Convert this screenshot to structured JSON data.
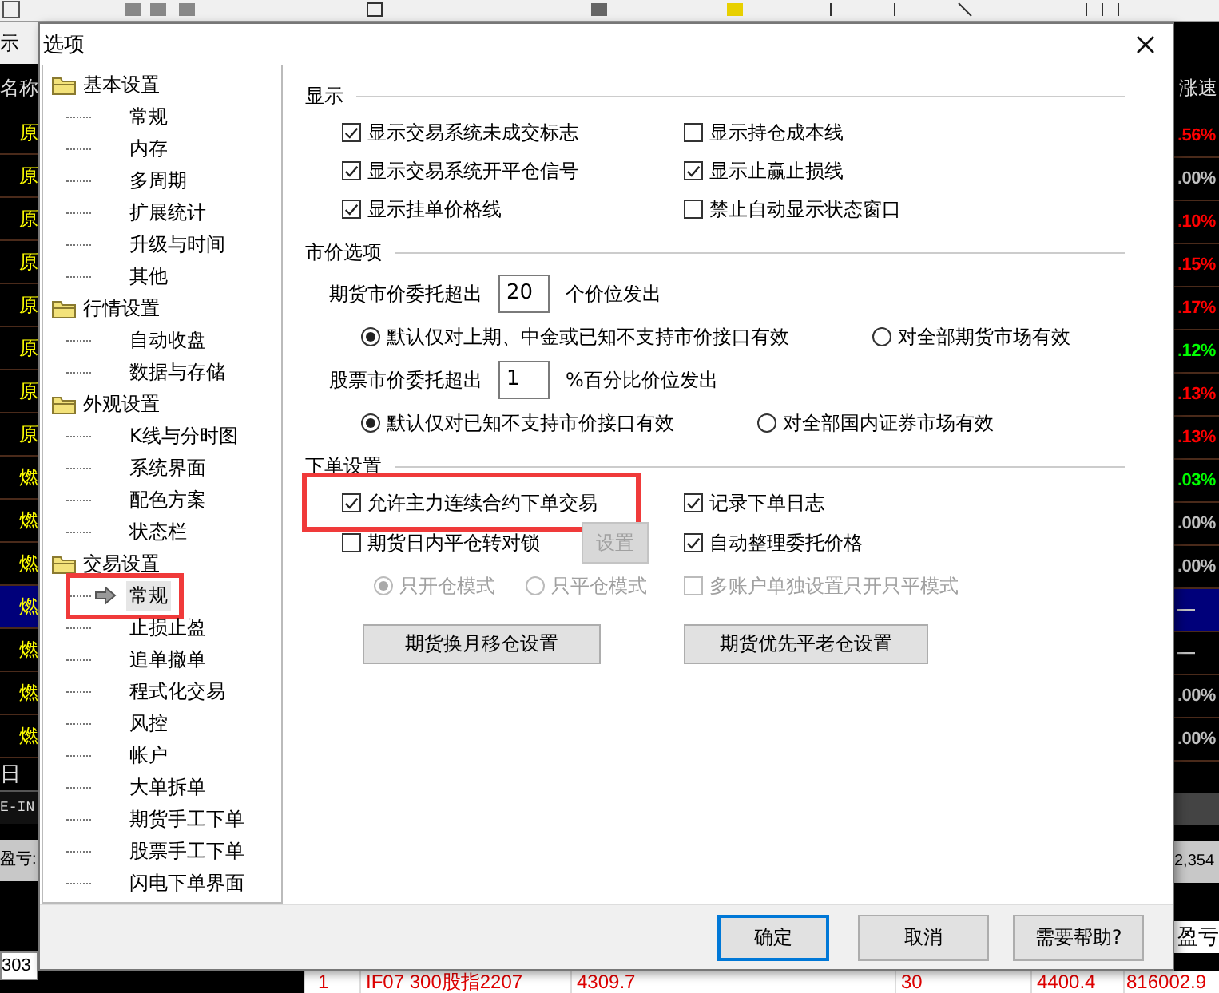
{
  "background": {
    "corner_label": "示",
    "left_header": "名称",
    "right_header": "涨速",
    "rows": [
      {
        "name": "原",
        "change": ".56%",
        "color": "#ff0000",
        "selected": false
      },
      {
        "name": "原",
        "change": ".00%",
        "color": "#c0c0c0",
        "selected": false
      },
      {
        "name": "原",
        "change": ".10%",
        "color": "#ff0000",
        "selected": false
      },
      {
        "name": "原",
        "change": ".15%",
        "color": "#ff0000",
        "selected": false
      },
      {
        "name": "原",
        "change": ".17%",
        "color": "#ff0000",
        "selected": false
      },
      {
        "name": "原",
        "change": ".12%",
        "color": "#00ff00",
        "selected": false
      },
      {
        "name": "原",
        "change": ".13%",
        "color": "#ff0000",
        "selected": false
      },
      {
        "name": "原",
        "change": ".13%",
        "color": "#ff0000",
        "selected": false
      },
      {
        "name": "燃",
        "change": ".03%",
        "color": "#00ff00",
        "selected": false
      },
      {
        "name": "燃",
        "change": ".00%",
        "color": "#c0c0c0",
        "selected": false
      },
      {
        "name": "燃",
        "change": ".00%",
        "color": "#c0c0c0",
        "selected": false
      },
      {
        "name": "燃",
        "change": "—",
        "color": "#c0c0c0",
        "selected": true
      },
      {
        "name": "燃",
        "change": "—",
        "color": "#c0c0c0",
        "selected": false
      },
      {
        "name": "燃",
        "change": ".00%",
        "color": "#c0c0c0",
        "selected": false
      },
      {
        "name": "燃",
        "change": ".00%",
        "color": "#c0c0c0",
        "selected": false
      }
    ],
    "day_label": "日",
    "code_label": "E-IN",
    "profit_label": "盈亏:",
    "total": "2,354",
    "profit_header": "盈亏",
    "quantity": "303",
    "order_row": [
      "1",
      "IF07 300股指2207",
      "4309.7",
      "30",
      "4400.4",
      "816002.9"
    ]
  },
  "dialog": {
    "title": "选项",
    "tree": [
      {
        "label": "基本设置",
        "expanded": true,
        "children": [
          {
            "label": "常规",
            "selected": false,
            "highlighted": false
          },
          {
            "label": "内存",
            "selected": false,
            "highlighted": false
          },
          {
            "label": "多周期",
            "selected": false,
            "highlighted": false
          },
          {
            "label": "扩展统计",
            "selected": false,
            "highlighted": false
          },
          {
            "label": "升级与时间",
            "selected": false,
            "highlighted": false
          },
          {
            "label": "其他",
            "selected": false,
            "highlighted": false
          }
        ]
      },
      {
        "label": "行情设置",
        "expanded": true,
        "children": [
          {
            "label": "自动收盘",
            "selected": false,
            "highlighted": false
          },
          {
            "label": "数据与存储",
            "selected": false,
            "highlighted": false
          }
        ]
      },
      {
        "label": "外观设置",
        "expanded": true,
        "children": [
          {
            "label": "K线与分时图",
            "selected": false,
            "highlighted": false
          },
          {
            "label": "系统界面",
            "selected": false,
            "highlighted": false
          },
          {
            "label": "配色方案",
            "selected": false,
            "highlighted": false
          },
          {
            "label": "状态栏",
            "selected": false,
            "highlighted": false
          }
        ]
      },
      {
        "label": "交易设置",
        "expanded": true,
        "children": [
          {
            "label": "常规",
            "selected": true,
            "highlighted": true
          },
          {
            "label": "止损止盈",
            "selected": false,
            "highlighted": false
          },
          {
            "label": "追单撤单",
            "selected": false,
            "highlighted": false
          },
          {
            "label": "程式化交易",
            "selected": false,
            "highlighted": false
          },
          {
            "label": "风控",
            "selected": false,
            "highlighted": false
          },
          {
            "label": "帐户",
            "selected": false,
            "highlighted": false
          },
          {
            "label": "大单拆单",
            "selected": false,
            "highlighted": false
          },
          {
            "label": "期货手工下单",
            "selected": false,
            "highlighted": false
          },
          {
            "label": "股票手工下单",
            "selected": false,
            "highlighted": false
          },
          {
            "label": "闪电下单界面",
            "selected": false,
            "highlighted": false
          }
        ]
      }
    ],
    "sections": [
      {
        "title": "显示",
        "rows": [
          {
            "kind": "pair",
            "items": [
              {
                "kind": "checkbox",
                "label": "显示交易系统未成交标志",
                "checked": true
              },
              {
                "kind": "checkbox",
                "label": "显示持仓成本线",
                "checked": false
              }
            ]
          },
          {
            "kind": "pair",
            "items": [
              {
                "kind": "checkbox",
                "label": "显示交易系统开平仓信号",
                "checked": true
              },
              {
                "kind": "checkbox",
                "label": "显示止赢止损线",
                "checked": true
              }
            ]
          },
          {
            "kind": "pair",
            "items": [
              {
                "kind": "checkbox",
                "label": "显示挂单价格线",
                "checked": true
              },
              {
                "kind": "checkbox",
                "label": "禁止自动显示状态窗口",
                "checked": false
              }
            ]
          }
        ]
      },
      {
        "title": "市价选项",
        "rows": [
          {
            "kind": "entry",
            "items": [
              {
                "kind": "label",
                "label": "期货市价委托超出"
              },
              {
                "kind": "input",
                "value": "20"
              },
              {
                "kind": "label",
                "label": "个价位发出"
              }
            ]
          },
          {
            "kind": "radios",
            "items": [
              {
                "kind": "radio",
                "label": "默认仅对上期、中金或已知不支持市价接口有效",
                "selected": true
              },
              {
                "kind": "radio",
                "label": "对全部期货市场有效",
                "selected": false
              }
            ]
          },
          {
            "kind": "entry",
            "items": [
              {
                "kind": "label",
                "label": "股票市价委托超出"
              },
              {
                "kind": "input",
                "value": "1"
              },
              {
                "kind": "label",
                "label": "%百分比价位发出"
              }
            ]
          },
          {
            "kind": "radios",
            "items": [
              {
                "kind": "radio",
                "label": "默认仅对已知不支持市价接口有效",
                "selected": true
              },
              {
                "kind": "radio",
                "label": "对全部国内证券市场有效",
                "selected": false
              }
            ]
          }
        ]
      },
      {
        "title": "下单设置",
        "rows": [
          {
            "kind": "pair",
            "items": [
              {
                "kind": "checkbox",
                "label": "允许主力连续合约下单交易",
                "checked": true,
                "disabled": false,
                "highlighted": true
              },
              {
                "kind": "checkbox",
                "label": "记录下单日志",
                "checked": true,
                "disabled": false,
                "highlighted": false
              }
            ]
          },
          {
            "kind": "pair",
            "items": [
              {
                "kind": "checkbox",
                "label": "期货日内平仓转对锁",
                "checked": false,
                "disabled": false
              },
              {
                "kind": "button",
                "label": "设置",
                "disabled": true
              },
              {
                "kind": "checkbox",
                "label": "自动整理委托价格",
                "checked": true,
                "disabled": false
              }
            ]
          },
          {
            "kind": "options",
            "items": [
              {
                "kind": "radio",
                "label": "只开仓模式",
                "selected": true,
                "disabled": true
              },
              {
                "kind": "radio",
                "label": "只平仓模式",
                "selected": false,
                "disabled": true
              },
              {
                "kind": "checkbox",
                "label": "多账户单独设置只开只平模式",
                "checked": false,
                "disabled": true
              }
            ]
          },
          {
            "kind": "buttons",
            "items": [
              {
                "kind": "button",
                "label": "期货换月移仓设置"
              },
              {
                "kind": "button",
                "label": "期货优先平老仓设置"
              }
            ]
          }
        ]
      }
    ],
    "buttons": [
      {
        "label": "确定",
        "default": true
      },
      {
        "label": "取消",
        "default": false
      },
      {
        "label": "需要帮助?",
        "default": false
      }
    ]
  }
}
